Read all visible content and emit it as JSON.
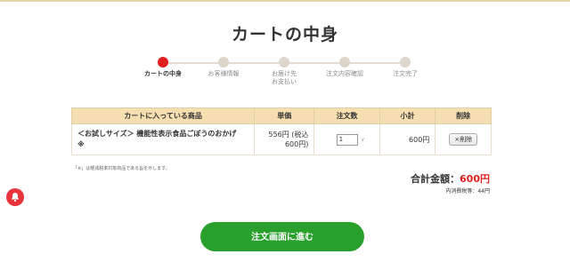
{
  "header": {
    "title": "カートの中身"
  },
  "steps": [
    {
      "label": "カートの中身",
      "active": true
    },
    {
      "label": "お客様情報",
      "active": false
    },
    {
      "label": "お届け先\nお支払い",
      "active": false
    },
    {
      "label": "注文内容確認",
      "active": false
    },
    {
      "label": "注文完了",
      "active": false
    }
  ],
  "cart": {
    "headers": {
      "product": "カートに入っている商品",
      "price": "単価",
      "quantity": "注文数",
      "subtotal": "小計",
      "delete": "削除"
    },
    "items": [
      {
        "name": "＜お試しサイズ＞ 機能性表示食品ごぼうのおかげ",
        "mark": "※",
        "price_line1": "556円 (税込",
        "price_line2": "600円)",
        "quantity": "1",
        "subtotal": "600円",
        "delete_label": "×削除"
      }
    ]
  },
  "note": "「※」は軽減税率対象商品である旨を示します。",
  "total": {
    "label": "合計金額：",
    "amount": "600円",
    "tax": "内消費税等：44円"
  },
  "checkout": {
    "label": "注文画面に進む"
  },
  "colors": {
    "accent": "#e02020",
    "checkout": "#2aa02c",
    "table_header": "#f5deb0",
    "bell": "#e8333a"
  },
  "icons": {
    "notification": "bell-icon",
    "select": "chevron-down-icon"
  }
}
